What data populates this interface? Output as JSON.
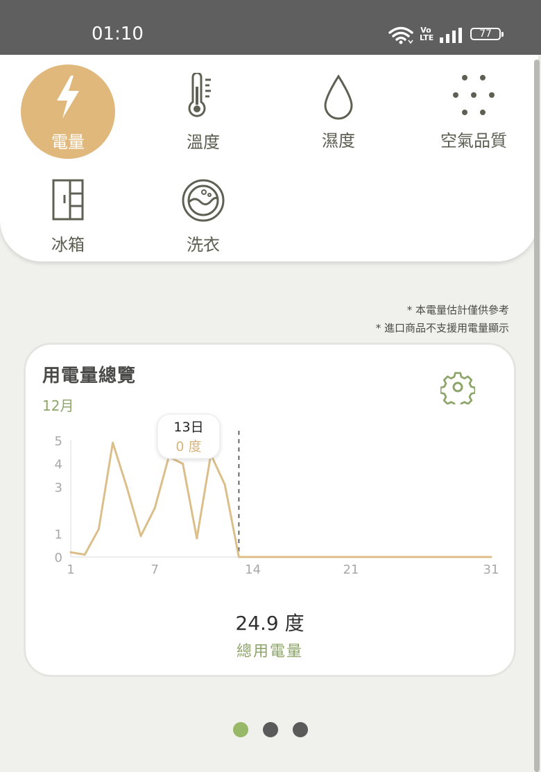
{
  "status_bar": {
    "time": "01:10",
    "battery": "77",
    "network": "LTE"
  },
  "categories": [
    {
      "label": "電量",
      "icon": "lightning-icon",
      "active": true
    },
    {
      "label": "溫度",
      "icon": "thermometer-icon",
      "active": false
    },
    {
      "label": "濕度",
      "icon": "water-drop-icon",
      "active": false
    },
    {
      "label": "空氣品質",
      "icon": "air-quality-dots-icon",
      "active": false
    },
    {
      "label": "冰箱",
      "icon": "fridge-icon",
      "active": false
    },
    {
      "label": "洗衣",
      "icon": "washing-machine-icon",
      "active": false
    }
  ],
  "notes": [
    "* 本電量估計僅供參考",
    "* 進口商品不支援用電量顯示"
  ],
  "card": {
    "title": "用電量總覽",
    "month": "12月",
    "settings_icon": "gear-icon",
    "total_value": "24.9 度",
    "total_label": "總用電量"
  },
  "tooltip": {
    "day": "13日",
    "value": "0 度"
  },
  "chart_data": {
    "type": "line",
    "x": [
      1,
      2,
      3,
      4,
      5,
      6,
      7,
      8,
      9,
      10,
      11,
      12,
      13,
      14,
      15,
      16,
      17,
      18,
      19,
      20,
      21,
      22,
      23,
      24,
      25,
      26,
      27,
      28,
      29,
      30,
      31
    ],
    "values": [
      0.2,
      0.1,
      1.2,
      4.9,
      3.0,
      0.9,
      2.1,
      4.3,
      4.0,
      0.8,
      4.4,
      3.1,
      0,
      0,
      0,
      0,
      0,
      0,
      0,
      0,
      0,
      0,
      0,
      0,
      0,
      0,
      0,
      0,
      0,
      0,
      0
    ],
    "x_ticks": [
      "1",
      "7",
      "14",
      "21",
      "31"
    ],
    "y_ticks": [
      "0",
      "1",
      "3",
      "4",
      "5"
    ],
    "ylim": [
      0,
      5
    ],
    "selected_day": 13,
    "line_color": "#dbbe8a"
  },
  "pager": {
    "count": 3,
    "active_index": 0,
    "active_color": "#97b866",
    "inactive_color": "#5a5a5a"
  },
  "colors": {
    "accent": "#e0b87c",
    "green": "#8ea56a",
    "icon_gray": "#5d6052"
  }
}
